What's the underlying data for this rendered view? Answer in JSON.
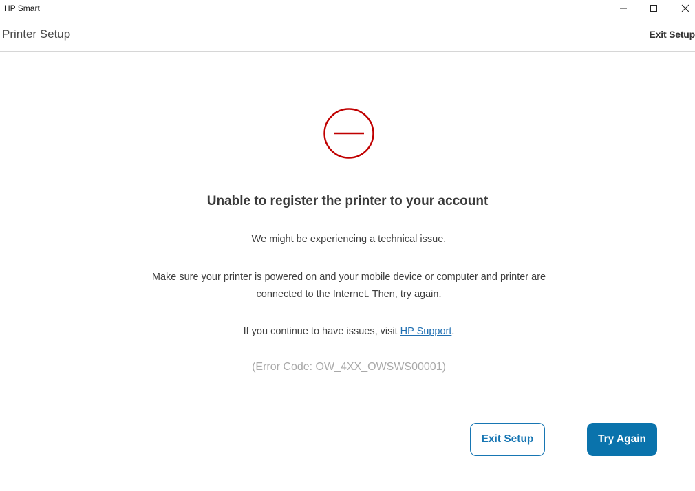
{
  "window": {
    "app_title": "HP Smart"
  },
  "header": {
    "page_title": "Printer Setup",
    "exit_label": "Exit Setup"
  },
  "status": {
    "icon": "error-minus-circle-icon",
    "icon_color": "#c00000"
  },
  "message": {
    "heading": "Unable to register the printer to your account",
    "line1": "We might be experiencing a technical issue.",
    "line2": "Make sure your printer is powered on and your mobile device or computer and printer are",
    "line3": "connected to the Internet. Then, try again.",
    "support_prefix": "If you continue to have issues, visit ",
    "support_link": "HP Support",
    "support_suffix": ".",
    "error_code": "(Error Code: OW_4XX_OWSWS00001)"
  },
  "actions": {
    "exit_label": "Exit Setup",
    "try_again_label": "Try Again"
  },
  "colors": {
    "accent": "#0a73ac",
    "link": "#1f6fb2"
  }
}
